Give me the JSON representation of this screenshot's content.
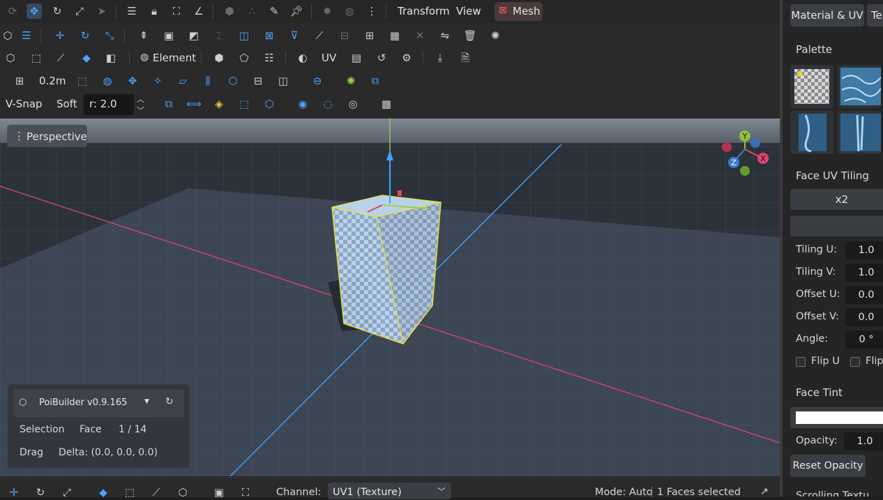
{
  "menu": {
    "transform": "Transform",
    "view": "View",
    "mesh": "Mesh"
  },
  "toolbar": {
    "element_label": "Element",
    "uv_label": "UV",
    "grid_size": "0.2m",
    "vsnap_label": "V-Snap",
    "soft_label": "Soft",
    "radius_value": "r: 2.0"
  },
  "viewport": {
    "camera_label": "Perspective",
    "axis_x": "X",
    "axis_y": "Y",
    "axis_z": "Z"
  },
  "info": {
    "app_version": "PoiBuilder v0.9.165",
    "selection_label": "Selection",
    "selection_mode": "Face",
    "selection_count": "1 / 14",
    "drag_label": "Drag",
    "drag_delta": "Delta: (0.0, 0.0, 0.0)"
  },
  "statusbar": {
    "channel_label": "Channel:",
    "channel_value": "UV1 (Texture)",
    "mode_text": "Mode: Auto",
    "selected_text": "1 Faces selected"
  },
  "panel": {
    "tab_material": "Material & UV",
    "tab_te": "Te",
    "palette_title": "Palette",
    "uv_tiling_title": "Face UV Tiling",
    "x2_label": "x2",
    "tiling_u_label": "Tiling U:",
    "tiling_u": "1.0",
    "tiling_v_label": "Tiling V:",
    "tiling_v": "1.0",
    "offset_u_label": "Offset U:",
    "offset_u": "0.0",
    "offset_v_label": "Offset V:",
    "offset_v": "0.0",
    "angle_label": "Angle:",
    "angle": "0 °",
    "flip_u": "Flip U",
    "flip_v": "Flip",
    "tint_title": "Face Tint",
    "opacity_label": "Opacity:",
    "opacity": "1.0",
    "reset_opacity": "Reset Opacity",
    "cut_text": "Scrolling Textu"
  },
  "colors": {
    "accent": "#4aa3ff",
    "mesh": "#ff5a5a",
    "selection": "#e8e03a"
  }
}
